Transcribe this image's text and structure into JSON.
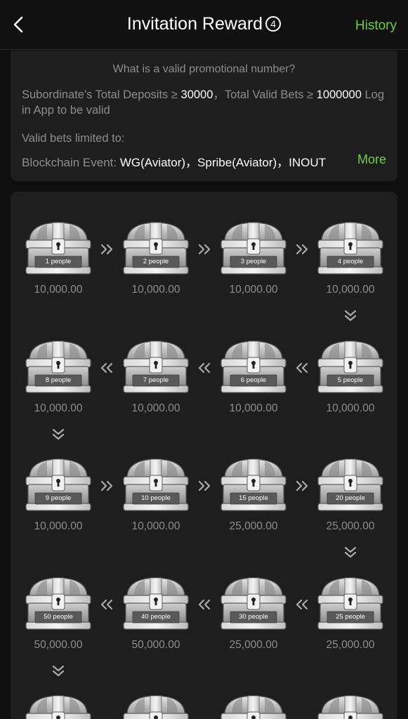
{
  "header": {
    "title": "Invitation Reward",
    "info_badge": "4",
    "history_label": "History"
  },
  "info": {
    "question": "What is a valid promotional number?",
    "req_prefix": "Subordinate's Total Deposits ≥ ",
    "req_deposit": "30000",
    "req_middle": "，Total Valid Bets ≥ ",
    "req_bets": "1000000",
    "req_suffix": " Log in App to be valid",
    "valid_bets_label": "Valid bets limited to:",
    "blockchain_label": "Blockchain Event: ",
    "blockchain_value": "WG(Aviator)，Spribe(Aviator)，INOUT",
    "more_label": "More"
  },
  "rewards": [
    {
      "people": "1 people",
      "amount": "10,000.00"
    },
    {
      "people": "2 people",
      "amount": "10,000.00"
    },
    {
      "people": "3 people",
      "amount": "10,000.00"
    },
    {
      "people": "4 people",
      "amount": "10,000.00"
    },
    {
      "people": "5 people",
      "amount": "10,000.00"
    },
    {
      "people": "6 people",
      "amount": "10,000.00"
    },
    {
      "people": "7 people",
      "amount": "10,000.00"
    },
    {
      "people": "8 people",
      "amount": "10,000.00"
    },
    {
      "people": "9 people",
      "amount": "10,000.00"
    },
    {
      "people": "10 people",
      "amount": "10,000.00"
    },
    {
      "people": "15 people",
      "amount": "25,000.00"
    },
    {
      "people": "20 people",
      "amount": "25,000.00"
    },
    {
      "people": "25 people",
      "amount": "25,000.00"
    },
    {
      "people": "30 people",
      "amount": "25,000.00"
    },
    {
      "people": "40 people",
      "amount": "50,000.00"
    },
    {
      "people": "50 people",
      "amount": "50,000.00"
    },
    {
      "people": "",
      "amount": ""
    },
    {
      "people": "",
      "amount": ""
    },
    {
      "people": "",
      "amount": ""
    },
    {
      "people": "",
      "amount": ""
    }
  ],
  "colors": {
    "accent": "#6cd13c",
    "card": "#1e1e1e",
    "muted": "#8d8d8d"
  }
}
